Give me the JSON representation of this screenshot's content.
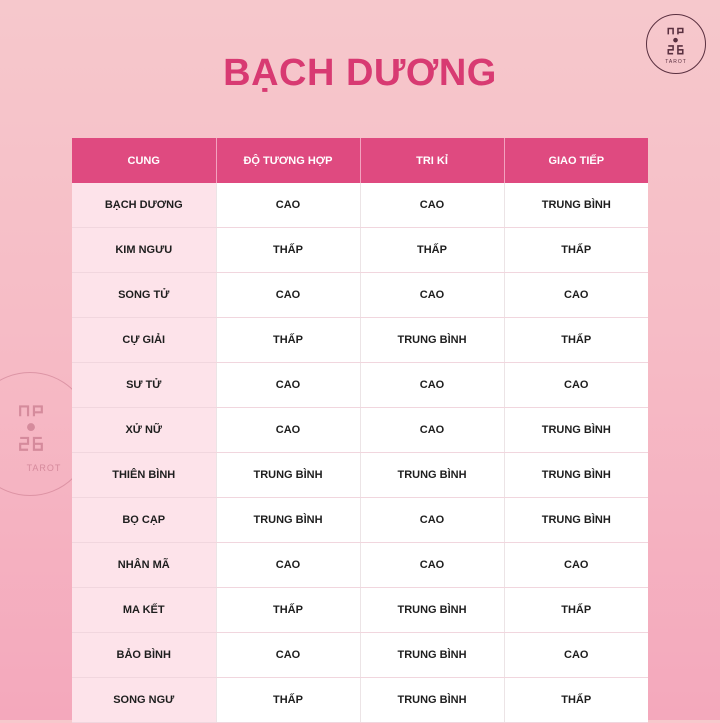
{
  "title": "BẠCH DƯƠNG",
  "logo": {
    "text": "TAROT"
  },
  "table": {
    "headers": [
      "CUNG",
      "ĐỘ TƯƠNG HỢP",
      "TRI KỈ",
      "GIAO TIẾP"
    ],
    "rows": [
      [
        "BẠCH DƯƠNG",
        "CAO",
        "CAO",
        "TRUNG BÌNH"
      ],
      [
        "KIM NGƯU",
        "THẤP",
        "THẤP",
        "THẤP"
      ],
      [
        "SONG TỬ",
        "CAO",
        "CAO",
        "CAO"
      ],
      [
        "CỰ GIẢI",
        "THẤP",
        "TRUNG BÌNH",
        "THẤP"
      ],
      [
        "SƯ TỬ",
        "CAO",
        "CAO",
        "CAO"
      ],
      [
        "XỬ NỮ",
        "CAO",
        "CAO",
        "TRUNG BÌNH"
      ],
      [
        "THIÊN BÌNH",
        "TRUNG BÌNH",
        "TRUNG BÌNH",
        "TRUNG BÌNH"
      ],
      [
        "BỌ CẠP",
        "TRUNG BÌNH",
        "CAO",
        "TRUNG BÌNH"
      ],
      [
        "NHÂN MÃ",
        "CAO",
        "CAO",
        "CAO"
      ],
      [
        "MA KẾT",
        "THẤP",
        "TRUNG BÌNH",
        "THẤP"
      ],
      [
        "BẢO BÌNH",
        "CAO",
        "TRUNG BÌNH",
        "CAO"
      ],
      [
        "SONG NGƯ",
        "THẤP",
        "TRUNG BÌNH",
        "THẤP"
      ]
    ]
  },
  "colors": {
    "title": "#d83a72",
    "header_bg": "#df4a80",
    "sign_cell_bg": "#fde3ea"
  }
}
